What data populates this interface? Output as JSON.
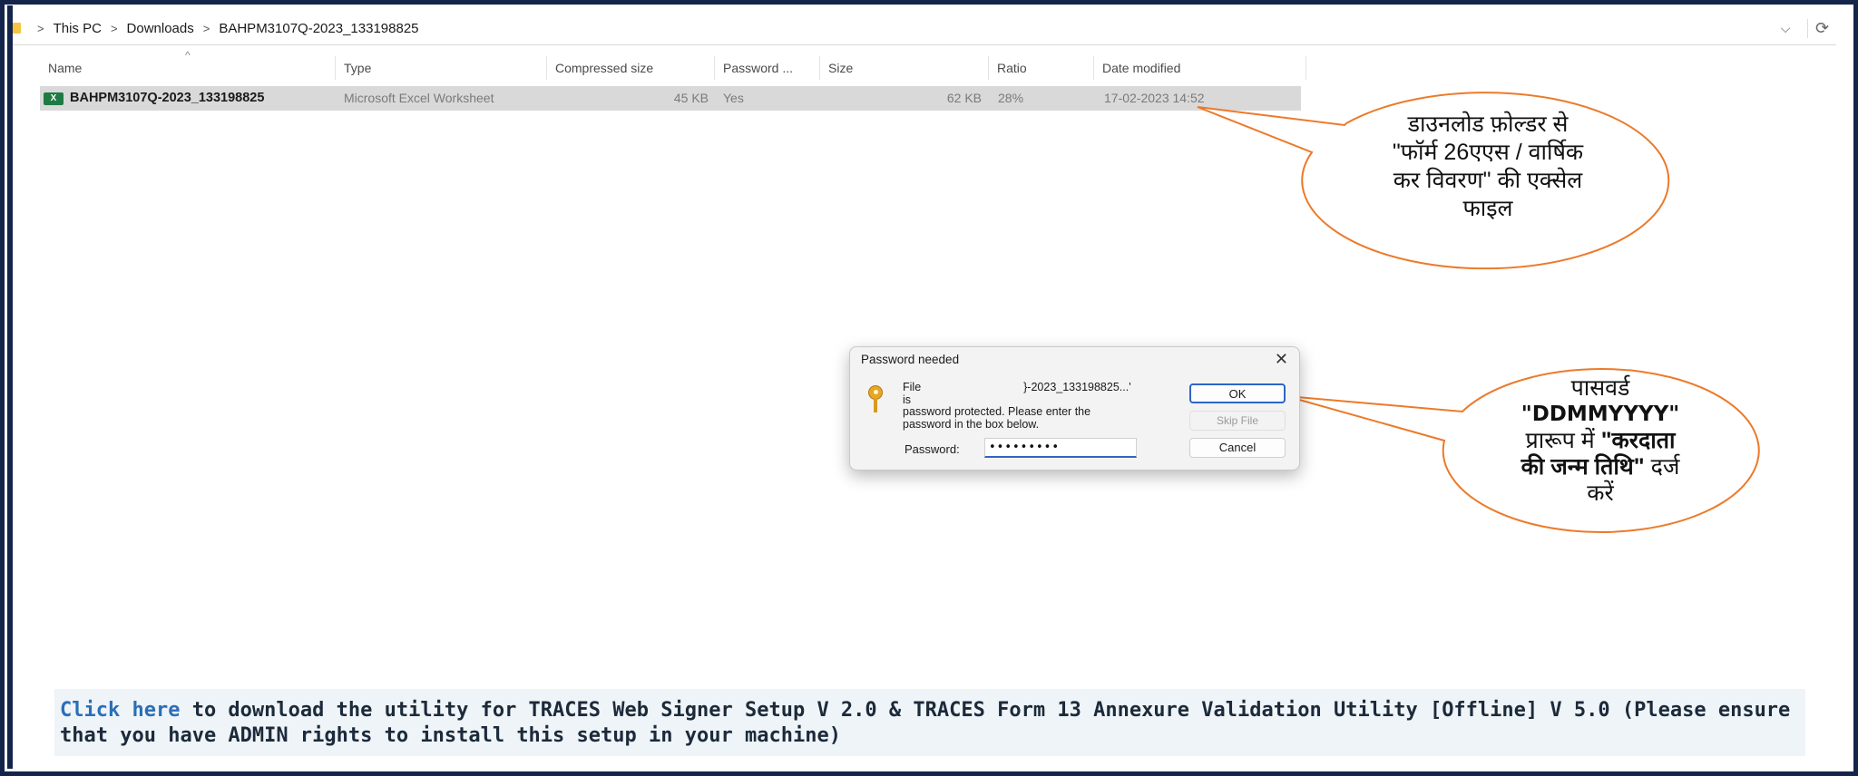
{
  "breadcrumb": {
    "items": [
      "This PC",
      "Downloads",
      "BAHPM3107Q-2023_133198825"
    ],
    "separator": ">"
  },
  "address_controls": {
    "dropdown_glyph": "⌵",
    "refresh_glyph": "⟳"
  },
  "columns": [
    "Name",
    "Type",
    "Compressed size",
    "Password ...",
    "Size",
    "Ratio",
    "Date modified"
  ],
  "sort_glyph": "^",
  "file": {
    "name": "BAHPM3107Q-2023_133198825",
    "type": "Microsoft Excel Worksheet",
    "compressed_size": "45 KB",
    "password": "Yes",
    "size": "62 KB",
    "ratio": "28%",
    "date_modified": "17-02-2023 14:52",
    "icon": "excel-file-icon"
  },
  "dialog": {
    "title": "Password needed",
    "close_glyph": "✕",
    "message_file_prefix": "File",
    "message_file_suffix": "}-2023_133198825...' is",
    "message_rest": "password protected.  Please enter the password in the box below.",
    "password_label": "Password:",
    "password_value": "•••••••••",
    "ok_label": "OK",
    "skip_label": "Skip File",
    "cancel_label": "Cancel",
    "icon": "key-icon"
  },
  "callouts": {
    "first": {
      "line1": "डाउनलोड फ़ोल्डर से",
      "line2": "\"फॉर्म 26एएस / वार्षिक",
      "line3": "कर विवरण\" की एक्सेल",
      "line4": "फाइल"
    },
    "second": {
      "line1": "पासवर्ड",
      "line2": "\"DDMMYYYY\"",
      "line3_pre": "प्रारूप में ",
      "line3_bold": "\"करदाता",
      "line4_bold": "की जन्म तिथि\"",
      "line4_post": " दर्ज",
      "line5": "करें"
    },
    "stroke_color": "#ec7a2a"
  },
  "banner": {
    "link_text": "Click here",
    "text": " to download the utility for TRACES Web Signer Setup V 2.0 & TRACES Form 13 Annexure Validation Utility [Offline] V 5.0 (Please ensure that you have ADMIN rights to install this setup in your machine)"
  },
  "colors": {
    "frame": "#14244a",
    "selection": "#d9d9d9",
    "link": "#2a6fb8",
    "accent_blue": "#2d65c8"
  }
}
